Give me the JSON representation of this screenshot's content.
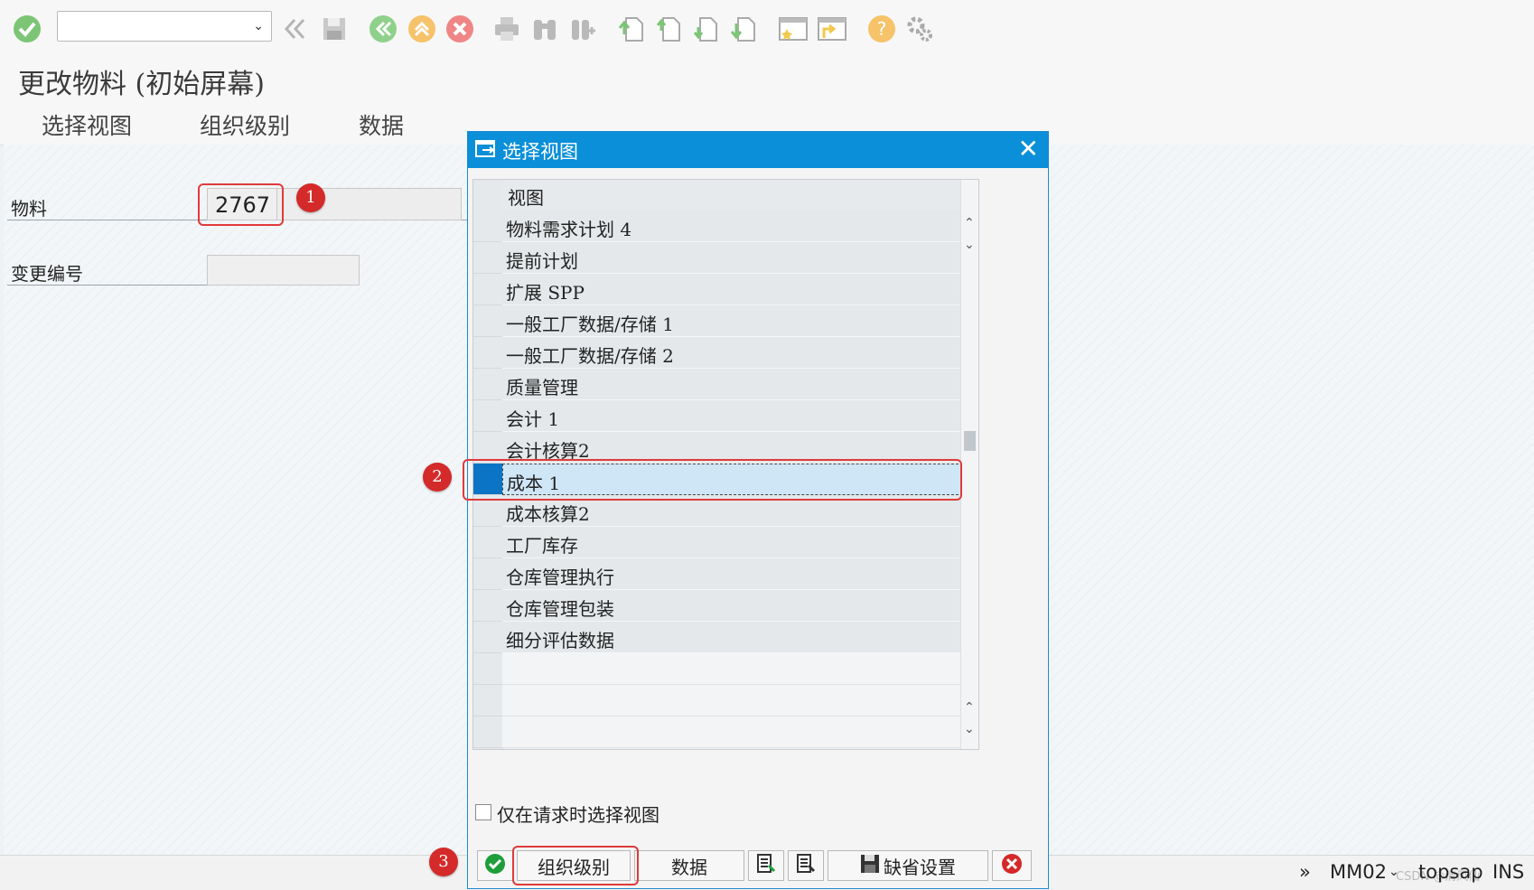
{
  "toolbar": {
    "command_field_value": "",
    "icons": [
      "enter-check-icon",
      "dropdown-chevron-icon",
      "double-left-icon",
      "save-icon",
      "back-icon",
      "exit-icon",
      "cancel-icon",
      "print-icon",
      "find-icon",
      "find-next-icon",
      "first-page-icon",
      "previous-page-icon",
      "next-page-icon",
      "last-page-icon",
      "create-session-icon",
      "shortcut-icon",
      "help-icon",
      "settings-icon"
    ]
  },
  "title": "更改物料 (初始屏幕)",
  "menu": {
    "items": [
      "选择视图",
      "组织级别",
      "数据"
    ]
  },
  "form": {
    "material_label": "物料",
    "material_value": "2767",
    "change_number_label": "变更编号",
    "change_number_value": ""
  },
  "annotations": {
    "badge1": "1",
    "badge2": "2",
    "badge3": "3",
    "color": "#d42a2a"
  },
  "dialog": {
    "title": "选择视图",
    "column_header": "视图",
    "rows": [
      "物料需求计划 4",
      "提前计划",
      "扩展 SPP",
      "一般工厂数据/存储 1",
      "一般工厂数据/存储 2",
      "质量管理",
      "会计 1",
      "会计核算2",
      "成本 1",
      "成本核算2",
      "工厂库存",
      "仓库管理执行",
      "仓库管理包装",
      "细分评估数据"
    ],
    "selected_row": "成本 1",
    "checkbox_label": "仅在请求时选择视图",
    "buttons": {
      "org_levels": "组织级别",
      "data": "数据",
      "default_values": "缺省设置"
    }
  },
  "statusbar": {
    "more": "»",
    "transaction": "MM02",
    "system": "topsap",
    "mode": "INS",
    "watermark": "CSDN @清风仙"
  },
  "colors": {
    "dialog_header": "#0a8fd8",
    "selection": "#0b74c4",
    "selected_row_bg": "#cfe6f6"
  }
}
